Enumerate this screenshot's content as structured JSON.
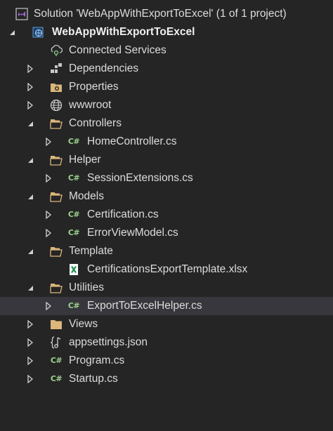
{
  "solution_explorer": {
    "solution_label": "Solution 'WebAppWithExportToExcel' (1 of 1 project)",
    "project_label": "WebAppWithExportToExcel",
    "items": [
      {
        "label": "Connected Services",
        "icon": "connected-services-icon"
      },
      {
        "label": "Dependencies",
        "icon": "dependencies-icon"
      },
      {
        "label": "Properties",
        "icon": "properties-folder-icon"
      },
      {
        "label": "wwwroot",
        "icon": "globe-icon"
      },
      {
        "label": "Controllers",
        "icon": "folder-open-icon"
      },
      {
        "label": "HomeController.cs",
        "icon": "csharp-file-icon"
      },
      {
        "label": "Helper",
        "icon": "folder-open-icon"
      },
      {
        "label": "SessionExtensions.cs",
        "icon": "csharp-file-icon"
      },
      {
        "label": "Models",
        "icon": "folder-open-icon"
      },
      {
        "label": "Certification.cs",
        "icon": "csharp-file-icon"
      },
      {
        "label": "ErrorViewModel.cs",
        "icon": "csharp-file-icon"
      },
      {
        "label": "Template",
        "icon": "folder-open-icon"
      },
      {
        "label": "CertificationsExportTemplate.xlsx",
        "icon": "excel-file-icon"
      },
      {
        "label": "Utilities",
        "icon": "folder-open-icon"
      },
      {
        "label": "ExportToExcelHelper.cs",
        "icon": "csharp-file-icon"
      },
      {
        "label": "Views",
        "icon": "folder-icon"
      },
      {
        "label": "appsettings.json",
        "icon": "json-file-icon"
      },
      {
        "label": "Program.cs",
        "icon": "csharp-file-icon"
      },
      {
        "label": "Startup.cs",
        "icon": "csharp-file-icon"
      }
    ],
    "colors": {
      "background": "#252526",
      "selected_row": "#37373d",
      "folder": "#dcb67a",
      "csharp": "#9bd28a",
      "excel": "#1d8f4e"
    }
  }
}
